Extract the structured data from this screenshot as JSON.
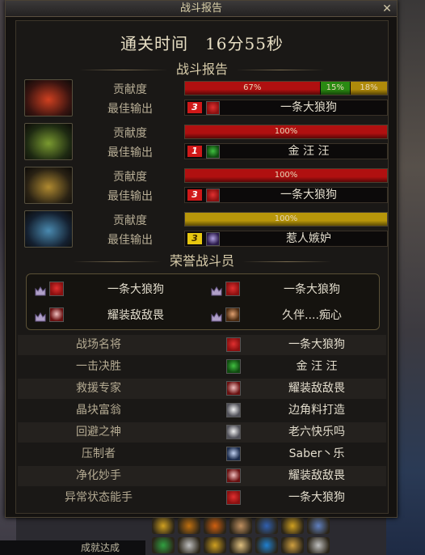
{
  "window": {
    "title": "战斗报告",
    "close_glyph": "✕"
  },
  "clear_time": "通关时间　16分55秒",
  "report_heading": "战斗报告",
  "labels": {
    "contribution": "贡献度",
    "best_output": "最佳输出"
  },
  "players": [
    {
      "portrait_icon": "red-helmet-portrait",
      "contribution_segments": [
        {
          "percent": 67,
          "label": "67%",
          "color": "#b01010"
        },
        {
          "percent": 15,
          "label": "15%",
          "color": "#2a8a12"
        },
        {
          "percent": 18,
          "label": "18%",
          "color": "#b08a0a"
        }
      ],
      "best_rank": "3",
      "best_rank_color": "#d01818",
      "best_icon": "red-job-icon",
      "best_name": "一条大狼狗"
    },
    {
      "portrait_icon": "green-helmet-portrait",
      "contribution_segments": [
        {
          "percent": 100,
          "label": "100%",
          "color": "#b01010"
        }
      ],
      "best_rank": "1",
      "best_rank_color": "#d01818",
      "best_icon": "green-job-icon",
      "best_name": "金 汪 汪"
    },
    {
      "portrait_icon": "gold-helmet-portrait",
      "contribution_segments": [
        {
          "percent": 100,
          "label": "100%",
          "color": "#b01010"
        }
      ],
      "best_rank": "3",
      "best_rank_color": "#d01818",
      "best_icon": "red-job-icon",
      "best_name": "一条大狼狗"
    },
    {
      "portrait_icon": "blue-helmet-portrait",
      "contribution_segments": [
        {
          "percent": 100,
          "label": "100%",
          "color": "#b8960a"
        }
      ],
      "best_rank": "3",
      "best_rank_color": "#e8c810",
      "best_icon": "purple-job-icon",
      "best_name": "惹人嫉妒"
    }
  ],
  "honor_heading": "荣誉战斗员",
  "honor_members": [
    {
      "name": "一条大狼狗",
      "icon": "red-job-icon"
    },
    {
      "name": "一条大狼狗",
      "icon": "red-job-icon"
    },
    {
      "name": "耀装敌敌畏",
      "icon": "redhair-job-icon"
    },
    {
      "name": "久伴....痴心",
      "icon": "brown-job-icon"
    }
  ],
  "awards": [
    {
      "title": "战场名将",
      "name": "一条大狼狗",
      "icon": "red-job-icon"
    },
    {
      "title": "一击决胜",
      "name": "金 汪 汪",
      "icon": "green-job-icon"
    },
    {
      "title": "救援专家",
      "name": "耀装敌敌畏",
      "icon": "redhair-job-icon"
    },
    {
      "title": "晶块富翁",
      "name": "边角料打造",
      "icon": "white-job-icon"
    },
    {
      "title": "回避之神",
      "name": "老六快乐吗",
      "icon": "white-job-icon"
    },
    {
      "title": "压制者",
      "name": "Saber丶乐",
      "icon": "blue-job-icon"
    },
    {
      "title": "净化妙手",
      "name": "耀装敌敌畏",
      "icon": "redhair-job-icon"
    },
    {
      "title": "异常状态能手",
      "name": "一条大狼狗",
      "icon": "red-job-icon"
    }
  ],
  "colors": {
    "gold_text": "#e8dfc4",
    "frame": "#4a4234"
  },
  "hotbar_icons": [
    "sword-skill-icon",
    "house-icon",
    "compass-icon",
    "face-icon",
    "calendar-icon",
    "coin-icon",
    "gem-icon",
    "green-book-icon",
    "scroll-icon",
    "d-icon",
    "smile-icon",
    "tp-icon",
    "chest-icon",
    "gear-icon"
  ],
  "bottom_text": "成就达成"
}
